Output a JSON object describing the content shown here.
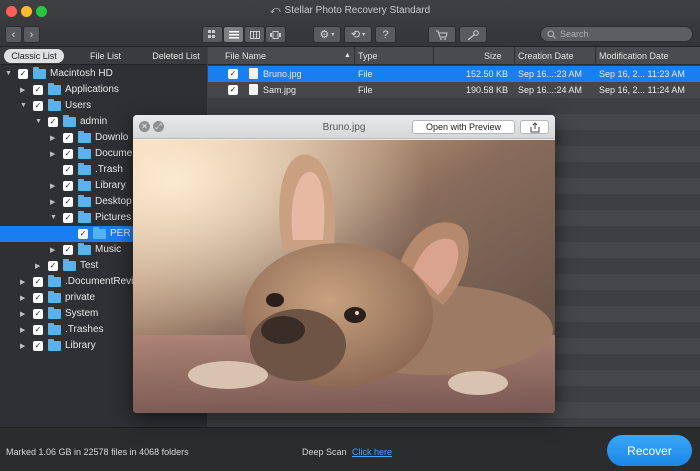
{
  "window": {
    "title": "Stellar Photo Recovery Standard"
  },
  "toolbar": {
    "search_placeholder": "Search",
    "help_label": "?"
  },
  "sidebar": {
    "tabs": [
      {
        "label": "Classic List",
        "active": true
      },
      {
        "label": "File List",
        "active": false
      },
      {
        "label": "Deleted List",
        "active": false
      }
    ],
    "tree": [
      {
        "label": "Macintosh HD",
        "depth": 0,
        "expanded": true,
        "checked": true,
        "selected": false
      },
      {
        "label": "Applications",
        "depth": 1,
        "expanded": false,
        "checked": true,
        "selected": false
      },
      {
        "label": "Users",
        "depth": 1,
        "expanded": true,
        "checked": true,
        "selected": false
      },
      {
        "label": "admin",
        "depth": 2,
        "expanded": true,
        "checked": true,
        "selected": false
      },
      {
        "label": "Downlo",
        "depth": 3,
        "expanded": false,
        "checked": true,
        "selected": false
      },
      {
        "label": "Docume",
        "depth": 3,
        "expanded": false,
        "checked": true,
        "selected": false
      },
      {
        "label": ".Trash",
        "depth": 3,
        "expanded": null,
        "checked": true,
        "selected": false
      },
      {
        "label": "Library",
        "depth": 3,
        "expanded": false,
        "checked": true,
        "selected": false
      },
      {
        "label": "Desktop",
        "depth": 3,
        "expanded": false,
        "checked": true,
        "selected": false
      },
      {
        "label": "Pictures",
        "depth": 3,
        "expanded": true,
        "checked": true,
        "selected": false
      },
      {
        "label": "PER",
        "depth": 4,
        "expanded": null,
        "checked": true,
        "selected": true
      },
      {
        "label": "Music",
        "depth": 3,
        "expanded": false,
        "checked": true,
        "selected": false
      },
      {
        "label": "Test",
        "depth": 2,
        "expanded": false,
        "checked": true,
        "selected": false
      },
      {
        "label": ".DocumentRevi",
        "depth": 1,
        "expanded": false,
        "checked": true,
        "selected": false
      },
      {
        "label": "private",
        "depth": 1,
        "expanded": false,
        "checked": true,
        "selected": false
      },
      {
        "label": "System",
        "depth": 1,
        "expanded": false,
        "checked": true,
        "selected": false
      },
      {
        "label": ".Trashes",
        "depth": 1,
        "expanded": false,
        "checked": true,
        "selected": false
      },
      {
        "label": "Library",
        "depth": 1,
        "expanded": false,
        "checked": true,
        "selected": false
      }
    ]
  },
  "filelist": {
    "columns": [
      "File Name",
      "Type",
      "Size",
      "Creation Date",
      "Modification Date"
    ],
    "rows": [
      {
        "name": "Bruno.jpg",
        "type": "File",
        "size": "152.50 KB",
        "created": "Sep 16...:23 AM",
        "modified": "Sep 16, 2... 11:23 AM",
        "selected": true
      },
      {
        "name": "Sam.jpg",
        "type": "File",
        "size": "190.58 KB",
        "created": "Sep 16...:24 AM",
        "modified": "Sep 16, 2... 11:24 AM",
        "selected": false
      }
    ]
  },
  "preview": {
    "title": "Bruno.jpg",
    "open_button": "Open with Preview"
  },
  "status": {
    "marked": "Marked 1.06 GB in 22578 files in 4068 folders",
    "deep_scan": "Deep Scan",
    "click_here": "Click here"
  },
  "recover_button": "Recover",
  "colors": {
    "accent": "#1a7ef1",
    "folder": "#56b4ec",
    "link": "#4aa3ff",
    "close": "#fc5f57",
    "minimize": "#fdbc2e",
    "zoom": "#27c840"
  }
}
